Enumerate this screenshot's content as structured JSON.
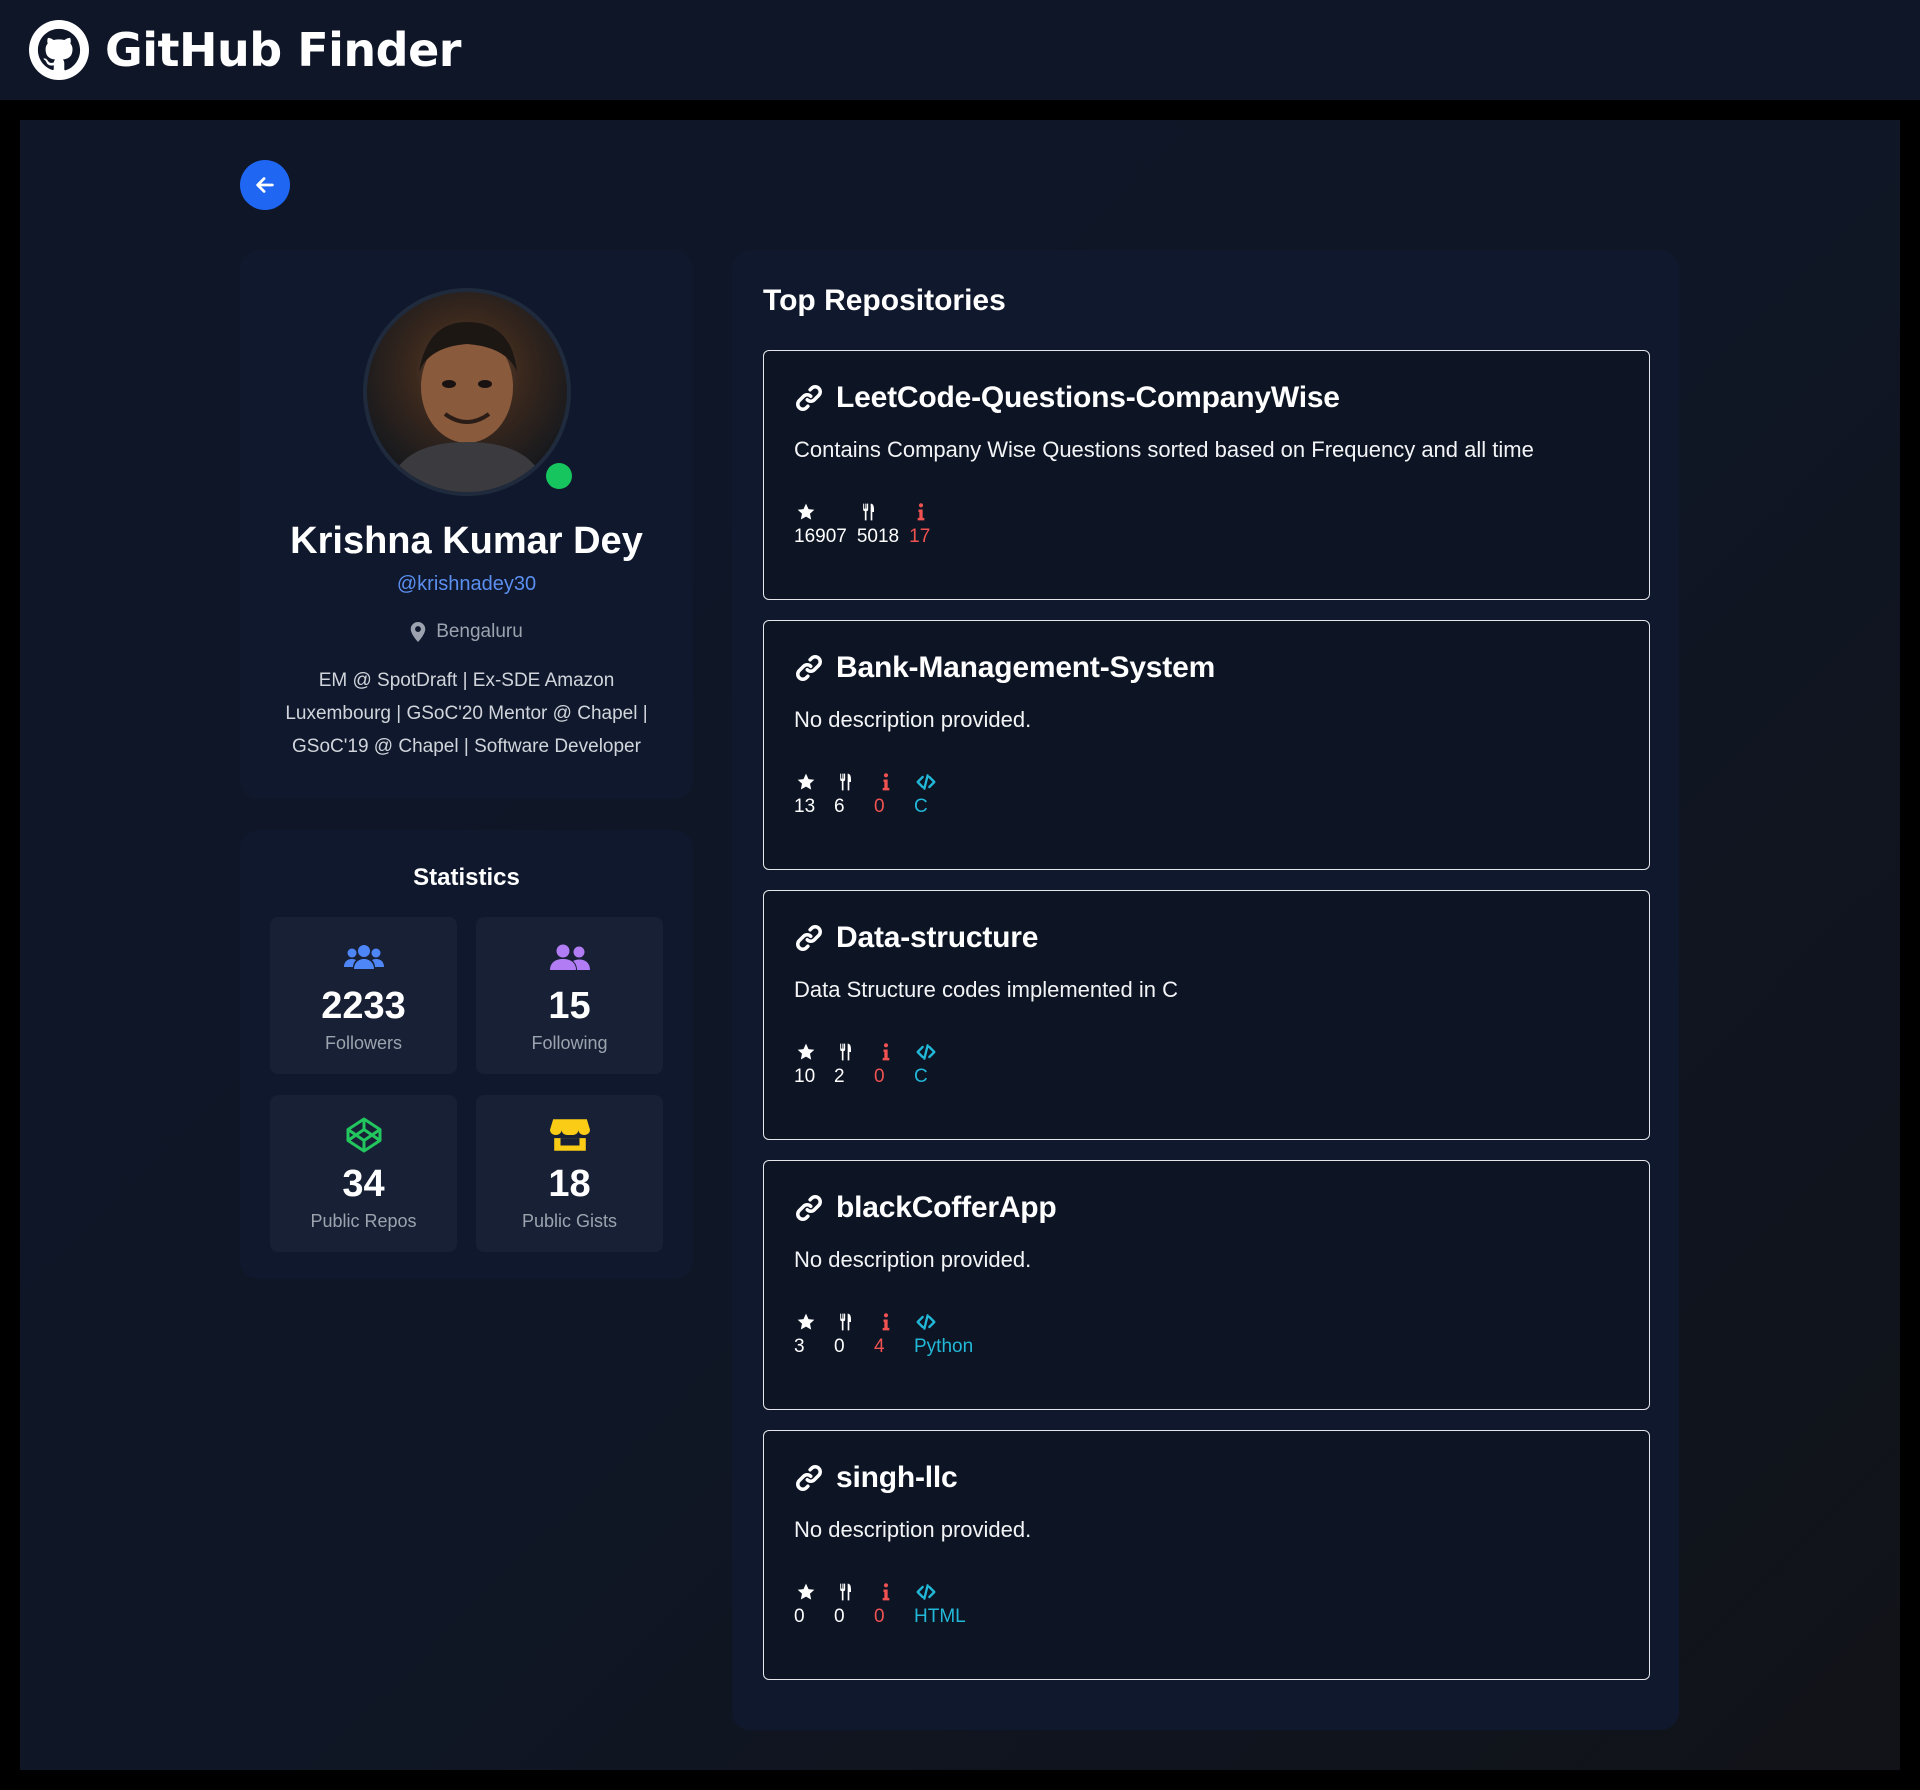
{
  "header": {
    "title": "GitHub Finder",
    "logo_icon": "github-icon"
  },
  "back_button": {
    "icon": "arrow-left-icon"
  },
  "profile": {
    "name": "Krishna Kumar Dey",
    "handle": "@krishnadey30",
    "location": "Bengaluru",
    "bio": "EM @ SpotDraft | Ex-SDE Amazon Luxembourg | GSoC'20 Mentor @ Chapel | GSoC'19 @ Chapel | Software Developer",
    "status": "online",
    "status_color": "#16c55e"
  },
  "statistics": {
    "title": "Statistics",
    "tiles": [
      {
        "value": "2233",
        "label": "Followers",
        "icon": "users-icon",
        "color": "#4f86f7"
      },
      {
        "value": "15",
        "label": "Following",
        "icon": "user-friends-icon",
        "color": "#b27cf5"
      },
      {
        "value": "34",
        "label": "Public Repos",
        "icon": "codepen-icon",
        "color": "#22c55e"
      },
      {
        "value": "18",
        "label": "Public Gists",
        "icon": "store-icon",
        "color": "#facc15"
      }
    ]
  },
  "repositories": {
    "title": "Top Repositories",
    "items": [
      {
        "name": "LeetCode-Questions-CompanyWise",
        "description": "Contains Company Wise Questions sorted based on Frequency and all time",
        "stars": "16907",
        "forks": "5018",
        "issues": "17",
        "language": ""
      },
      {
        "name": "Bank-Management-System",
        "description": "No description provided.",
        "stars": "13",
        "forks": "6",
        "issues": "0",
        "language": "C"
      },
      {
        "name": "Data-structure",
        "description": "Data Structure codes implemented in C",
        "stars": "10",
        "forks": "2",
        "issues": "0",
        "language": "C"
      },
      {
        "name": "blackCofferApp",
        "description": "No description provided.",
        "stars": "3",
        "forks": "0",
        "issues": "4",
        "language": "Python"
      },
      {
        "name": "singh-llc",
        "description": "No description provided.",
        "stars": "0",
        "forks": "0",
        "issues": "0",
        "language": "HTML"
      }
    ]
  },
  "colors": {
    "accent": "#1f66f2",
    "background": "#0e1628",
    "card": "#0f182c",
    "link": "#5b8ff0",
    "issues": "#f05252",
    "language": "#22b8d8"
  }
}
